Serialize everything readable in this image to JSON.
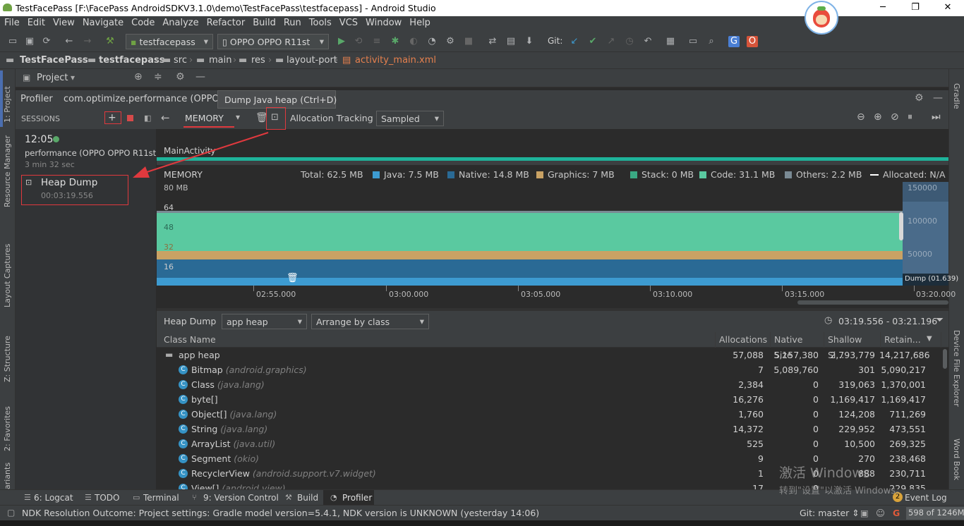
{
  "window": {
    "title": "TestFacePass [F:\\FacePass AndroidSDKV3.1.0\\demo\\TestFacePass\\testfacepass] - Android Studio",
    "minimize": "─",
    "maximize": "❐",
    "close": "✕"
  },
  "menu": [
    "File",
    "Edit",
    "View",
    "Navigate",
    "Code",
    "Analyze",
    "Refactor",
    "Build",
    "Run",
    "Tools",
    "VCS",
    "Window",
    "Help"
  ],
  "toolbar": {
    "module": "testfacepass",
    "device": "OPPO OPPO R11st",
    "git_label": "Git:"
  },
  "breadcrumb": [
    "TestFacePass",
    "testfacepass",
    "src",
    "main",
    "res",
    "layout-port",
    "activity_main.xml"
  ],
  "left_strip": [
    "1: Project",
    "Resource Manager",
    "Layout Captures",
    "Z: Structure",
    "2: Favorites",
    "ariants"
  ],
  "right_strip": [
    "Gradle",
    "Device File Explorer",
    "Word Book"
  ],
  "project_panel": {
    "title": "Project"
  },
  "profiler": {
    "tab": "Profiler",
    "process": "com.optimize.performance (OPPO OP",
    "tooltip": "Dump Java heap (Ctrl+D)"
  },
  "sessions": {
    "header": "SESSIONS",
    "time": "12:05",
    "name": "performance (OPPO OPPO R11st)",
    "duration": "3 min 32 sec",
    "heap_dump_title": "Heap Dump",
    "heap_dump_time": "00:03:19.556"
  },
  "memory_toolbar": {
    "profiler_select": "MEMORY",
    "allocation_label": "Allocation Tracking",
    "allocation_mode": "Sampled"
  },
  "timeline": {
    "activity": "MainActivity",
    "label": "MEMORY",
    "total": "Total: 62.5 MB",
    "legend": [
      {
        "label": "Java: 7.5 MB",
        "color": "#3d9bd1"
      },
      {
        "label": "Native: 14.8 MB",
        "color": "#2a6a95"
      },
      {
        "label": "Graphics: 7 MB",
        "color": "#c9a264"
      },
      {
        "label": "Stack: 0 MB",
        "color": "#3aa883"
      },
      {
        "label": "Code: 31.1 MB",
        "color": "#5ac9a0"
      },
      {
        "label": "Others: 2.2 MB",
        "color": "#7a8a94"
      }
    ],
    "allocated": "Allocated: N/A",
    "y_top": "80 MB",
    "y_labels": [
      "64",
      "48",
      "32",
      "16"
    ],
    "right_labels": [
      "150000",
      "100000",
      "50000"
    ],
    "dump_label": "Dump (01.639)",
    "ticks": [
      "02:55.000",
      "03:00.000",
      "03:05.000",
      "03:10.000",
      "03:15.000",
      "03:20.000"
    ]
  },
  "heap": {
    "label": "Heap Dump",
    "heap_select": "app heap",
    "arrange_select": "Arrange by class",
    "range": "03:19.556 - 03:21.196"
  },
  "table": {
    "columns": [
      "Class Name",
      "Allocations",
      "Native Size",
      "Shallow Si...",
      "Retain..."
    ],
    "rows": [
      {
        "name": "app heap",
        "pkg": "",
        "alloc": "57,088",
        "native": "5,157,380",
        "shallow": "2,793,779",
        "retained": "14,217,686"
      },
      {
        "name": "Bitmap",
        "pkg": "(android.graphics)",
        "alloc": "7",
        "native": "5,089,760",
        "shallow": "301",
        "retained": "5,090,217"
      },
      {
        "name": "Class",
        "pkg": "(java.lang)",
        "alloc": "2,384",
        "native": "0",
        "shallow": "319,063",
        "retained": "1,370,001"
      },
      {
        "name": "byte[]",
        "pkg": "",
        "alloc": "16,276",
        "native": "0",
        "shallow": "1,169,417",
        "retained": "1,169,417"
      },
      {
        "name": "Object[]",
        "pkg": "(java.lang)",
        "alloc": "1,760",
        "native": "0",
        "shallow": "124,208",
        "retained": "711,269"
      },
      {
        "name": "String",
        "pkg": "(java.lang)",
        "alloc": "14,372",
        "native": "0",
        "shallow": "229,952",
        "retained": "473,551"
      },
      {
        "name": "ArrayList",
        "pkg": "(java.util)",
        "alloc": "525",
        "native": "0",
        "shallow": "10,500",
        "retained": "269,325"
      },
      {
        "name": "Segment",
        "pkg": "(okio)",
        "alloc": "9",
        "native": "0",
        "shallow": "270",
        "retained": "238,468"
      },
      {
        "name": "RecyclerView",
        "pkg": "(android.support.v7.widget)",
        "alloc": "1",
        "native": "0",
        "shallow": "888",
        "retained": "230,711"
      },
      {
        "name": "View[]",
        "pkg": "(android.view)",
        "alloc": "17",
        "native": "0",
        "shallow": "",
        "retained": "229,835"
      }
    ]
  },
  "watermark": {
    "line1": "激活 Windows",
    "line2": "转到\"设置\"以激活 Windows。"
  },
  "bottom_tabs": [
    "6: Logcat",
    "TODO",
    "Terminal",
    "9: Version Control",
    "Build",
    "Profiler"
  ],
  "event_log": {
    "count": "2",
    "label": "Event Log"
  },
  "status": {
    "message": "NDK Resolution Outcome: Project settings: Gradle model version=5.4.1, NDK version is UNKNOWN (yesterday 14:06)",
    "git": "Git: master ⇕",
    "memory": "598 of 1246M"
  }
}
